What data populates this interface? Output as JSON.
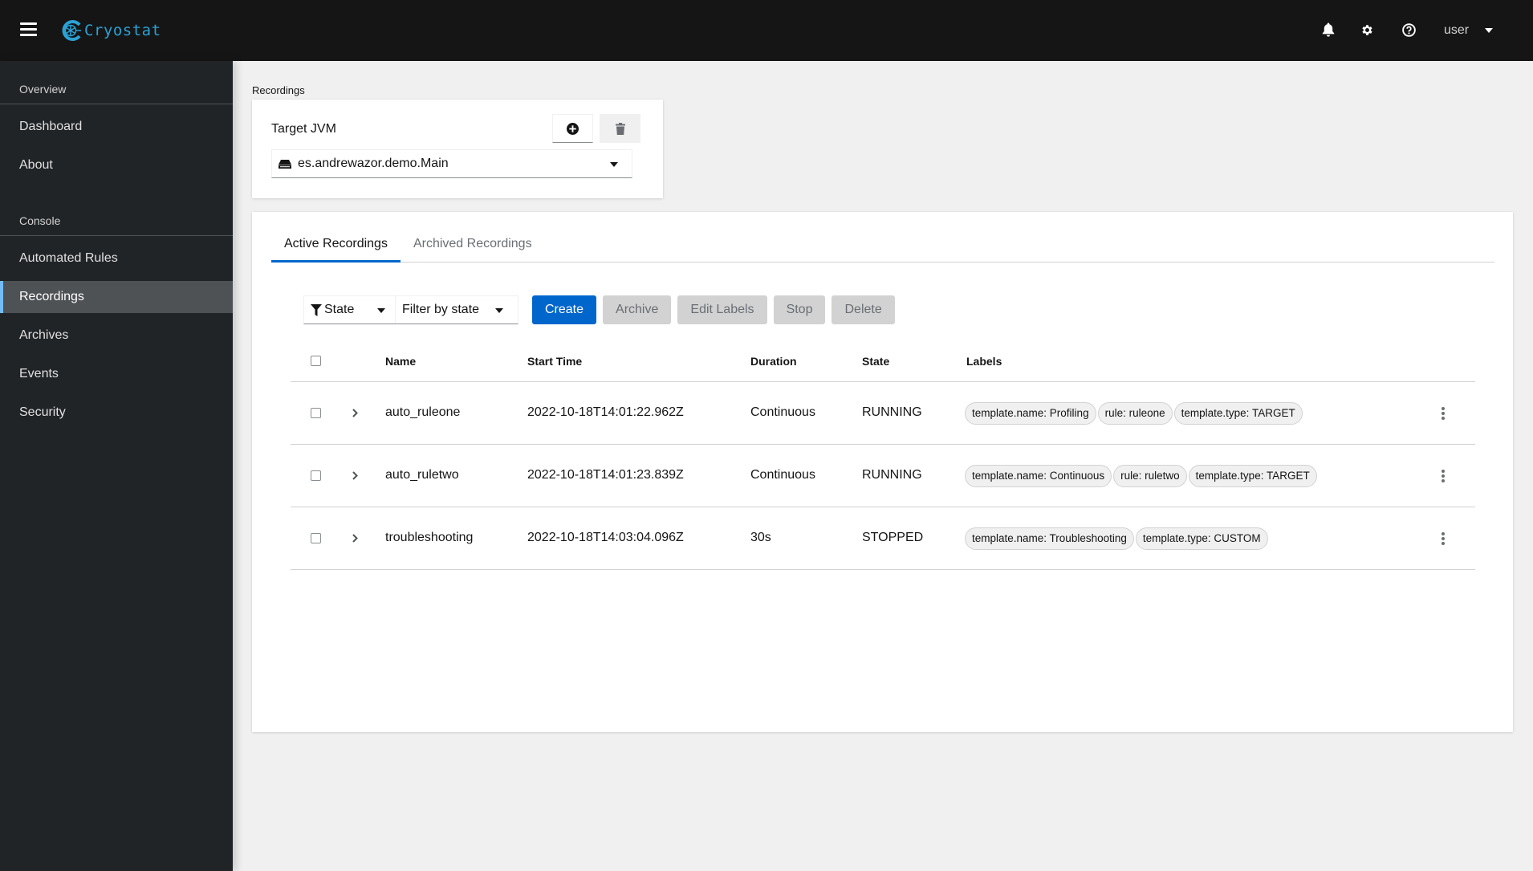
{
  "header": {
    "app_name": "Cryostat",
    "icons": [
      "menu-icon",
      "bell-icon",
      "gear-icon",
      "help-icon"
    ],
    "user": "user"
  },
  "sidebar": {
    "sections": [
      {
        "title": "Overview",
        "items": [
          {
            "label": "Dashboard"
          },
          {
            "label": "About"
          }
        ]
      },
      {
        "title": "Console",
        "items": [
          {
            "label": "Automated Rules"
          },
          {
            "label": "Recordings",
            "active": true
          },
          {
            "label": "Archives"
          },
          {
            "label": "Events"
          },
          {
            "label": "Security"
          }
        ]
      }
    ],
    "active_color": "#73bcf7"
  },
  "breadcrumb": "Recordings",
  "target": {
    "label": "Target JVM",
    "selected": "es.andrewazor.demo.Main",
    "icon": "server-icon"
  },
  "tabs": [
    {
      "label": "Active Recordings",
      "active": true
    },
    {
      "label": "Archived Recordings",
      "active": false
    }
  ],
  "toolbar": {
    "filter_attribute": "State",
    "filter_placeholder": "Filter by state",
    "create": "Create",
    "archive": "Archive",
    "edit_labels": "Edit Labels",
    "stop": "Stop",
    "delete": "Delete"
  },
  "table": {
    "columns": [
      "Name",
      "Start Time",
      "Duration",
      "State",
      "Labels"
    ],
    "rows": [
      {
        "name": "auto_ruleone",
        "start_time": "2022-10-18T14:01:22.962Z",
        "duration": "Continuous",
        "state": "RUNNING",
        "labels": [
          "template.name: Profiling",
          "rule: ruleone",
          "template.type: TARGET"
        ]
      },
      {
        "name": "auto_ruletwo",
        "start_time": "2022-10-18T14:01:23.839Z",
        "duration": "Continuous",
        "state": "RUNNING",
        "labels": [
          "template.name: Continuous",
          "rule: ruletwo",
          "template.type: TARGET"
        ]
      },
      {
        "name": "troubleshooting",
        "start_time": "2022-10-18T14:03:04.096Z",
        "duration": "30s",
        "state": "STOPPED",
        "labels": [
          "template.name: Troubleshooting",
          "template.type: CUSTOM"
        ]
      }
    ]
  },
  "colors": {
    "primary": "#0066cc",
    "brand": "#2ba1d4",
    "header_bg": "#151515",
    "sidebar_bg": "#212427"
  }
}
